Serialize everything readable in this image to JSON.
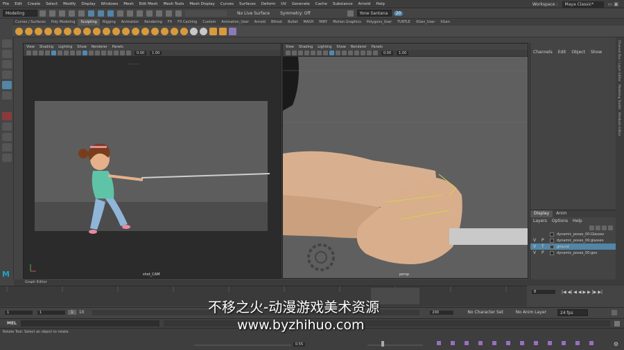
{
  "menubar": {
    "items": [
      "File",
      "Edit",
      "Create",
      "Select",
      "Modify",
      "Display",
      "Windows",
      "Mesh",
      "Edit Mesh",
      "Mesh Tools",
      "Mesh Display",
      "Curves",
      "Surfaces",
      "Deform",
      "UV",
      "Generate",
      "Cache",
      "Substance",
      "Arnold",
      "Help"
    ],
    "workspace_label": "Workspace :",
    "workspace_value": "Maya Classic*"
  },
  "statusline": {
    "mode": "Modeling",
    "live_surface": "No Live Surface",
    "symmetry": "Symmetry: Off",
    "user": "Yone Santana",
    "badge": "20"
  },
  "shelf": {
    "tabs": [
      "Curves / Surfaces",
      "Poly Modeling",
      "Sculpting",
      "Rigging",
      "Animation",
      "Rendering",
      "FX",
      "FX Caching",
      "Custom",
      "Animation_User",
      "Arnold",
      "Bifrost",
      "Bullet",
      "MASH",
      "MIRY",
      "Motion Graphics",
      "Polygons_User",
      "TURTLE",
      "XGen_User",
      "XGen"
    ],
    "active_tab": "Sculpting"
  },
  "viewport_left": {
    "menus": [
      "View",
      "Shading",
      "Lighting",
      "Show",
      "Renderer",
      "Panels"
    ],
    "field_a": "0.00",
    "field_b": "1.00",
    "camera_label": "shot_CAM",
    "hud_text": "—— ——"
  },
  "viewport_right": {
    "menus": [
      "View",
      "Shading",
      "Lighting",
      "Show",
      "Renderer",
      "Panels"
    ],
    "field_a": "0.00",
    "field_b": "1.00",
    "camera_label": "persp"
  },
  "channel_box": {
    "menus": [
      "Channels",
      "Edit",
      "Object",
      "Show"
    ],
    "tabs": [
      "Display",
      "Anim"
    ],
    "layer_menus": [
      "Layers",
      "Options",
      "Help"
    ],
    "layers": [
      {
        "v": "",
        "p": "",
        "name": "dynamic_poses_00:Glasses",
        "color": "#2a2a2a",
        "selected": false
      },
      {
        "v": "V",
        "p": "P",
        "name": "dynamic_poses_00:glasses",
        "color": "#2a2a2a",
        "selected": false
      },
      {
        "v": "V",
        "p": "T",
        "name": "ground",
        "color": "#3b3b3b",
        "selected": true
      },
      {
        "v": "V",
        "p": "P",
        "name": "dynamic_poses_00:geo",
        "color": "#2a2a2a",
        "selected": false
      }
    ],
    "side_tabs": [
      "Channel Box / Layer Editor",
      "Modeling Toolkit",
      "Attribute Editor"
    ]
  },
  "graph_editor_label": "Graph Editor",
  "timeline": {
    "current_frame": "8",
    "range_start": "1",
    "range_start2": "1",
    "range_inner": "1",
    "range_inner_end": "10",
    "range_end": "200",
    "character_set": "No Character Set",
    "anim_layer": "No Anim Layer",
    "fps": "24 fps"
  },
  "cmdline": {
    "label": "MEL"
  },
  "helpline": {
    "text": "Rotate Tool: Select an object to rotate.",
    "value": "0.55"
  },
  "watermark": {
    "line1": "不移之火-动漫游戏美术资源",
    "line2": "www.byzhihuo.com"
  },
  "colors": {
    "accent_blue": "#5285a6",
    "maya_logo": "#1fa3c4",
    "viewport_bg": "#2b2b2b",
    "camera_gate": "#5d5d5d"
  }
}
